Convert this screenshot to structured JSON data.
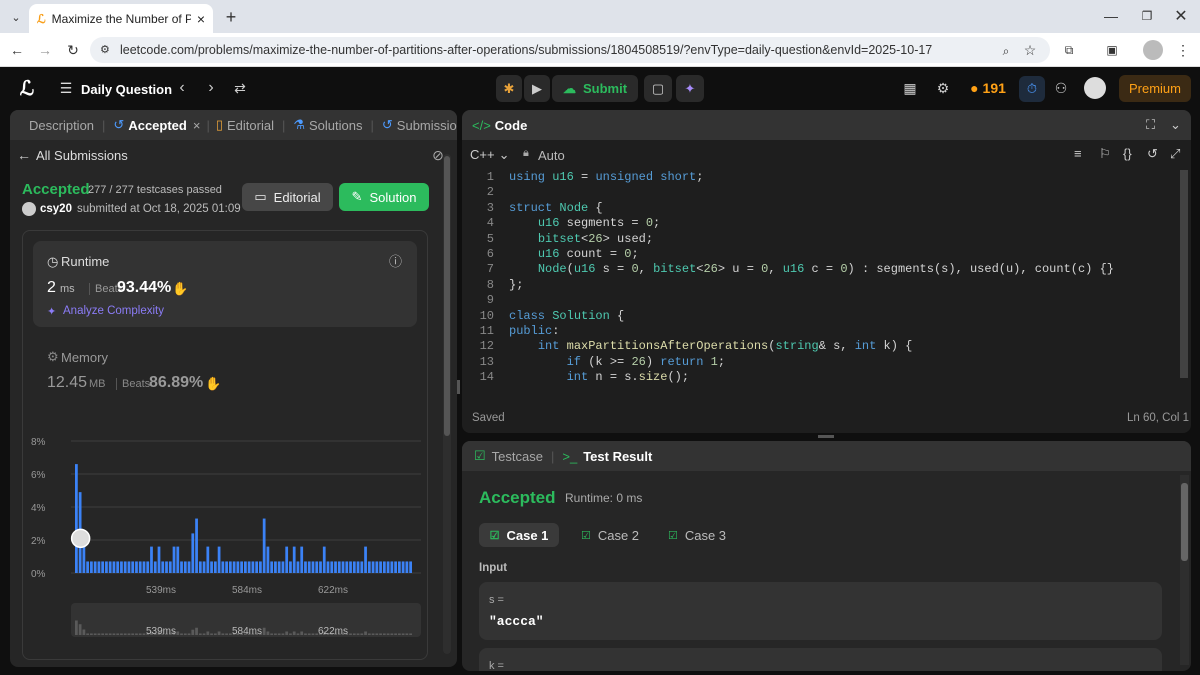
{
  "browser": {
    "tab_title": "Maximize the Number of Partitions",
    "url": "leetcode.com/problems/maximize-the-number-of-partitions-after-operations/submissions/1804508519/?envType=daily-question&envId=2025-10-17"
  },
  "nav": {
    "daily_label": "Daily Question",
    "submit_label": "Submit",
    "streak": "191",
    "premium_label": "Premium"
  },
  "left": {
    "tabs": [
      "Description",
      "Accepted",
      "Editorial",
      "Solutions",
      "Submission"
    ],
    "all_submissions": "All Submissions",
    "status": "Accepted",
    "testcases": "277 / 277 testcases passed",
    "user": "csy20",
    "submitted": "submitted at Oct 18, 2025 01:09",
    "editorial_btn": "Editorial",
    "solution_btn": "Solution",
    "runtime": {
      "label": "Runtime",
      "value": "2",
      "unit": "ms",
      "beats_label": "Beats",
      "beats": "93.44%",
      "analyze": "Analyze Complexity"
    },
    "memory": {
      "label": "Memory",
      "value": "12.45",
      "unit": "MB",
      "beats_label": "Beats",
      "beats": "86.89%"
    }
  },
  "chart_data": {
    "type": "bar",
    "y_ticks": [
      "8%",
      "6%",
      "4%",
      "2%",
      "0%"
    ],
    "ylim": [
      0,
      8
    ],
    "x_ticks": [
      "539ms",
      "584ms",
      "622ms"
    ],
    "values": [
      6.6,
      4.9,
      2.5,
      0.7,
      0.7,
      0.7,
      0.7,
      0.7,
      0.7,
      0.7,
      0.7,
      0.7,
      0.7,
      0.7,
      0.7,
      0.7,
      0.7,
      0.7,
      0.7,
      0.7,
      1.6,
      0.7,
      1.6,
      0.7,
      0.7,
      0.7,
      1.6,
      1.6,
      0.7,
      0.7,
      0.7,
      2.4,
      3.3,
      0.7,
      0.7,
      1.6,
      0.7,
      0.7,
      1.6,
      0.7,
      0.7,
      0.7,
      0.7,
      0.7,
      0.7,
      0.7,
      0.7,
      0.7,
      0.7,
      0.7,
      3.3,
      1.6,
      0.7,
      0.7,
      0.7,
      0.7,
      1.6,
      0.7,
      1.6,
      0.7,
      1.6,
      0.7,
      0.7,
      0.7,
      0.7,
      0.7,
      1.6,
      0.7,
      0.7,
      0.7,
      0.7,
      0.7,
      0.7,
      0.7,
      0.7,
      0.7,
      0.7,
      1.6,
      0.7,
      0.7,
      0.7,
      0.7,
      0.7,
      0.7,
      0.7,
      0.7,
      0.7,
      0.7,
      0.7,
      0.7
    ],
    "highlight_index": 1,
    "bar_color": "#3b82f6"
  },
  "code_panel": {
    "title": "Code",
    "language": "C++",
    "mode": "Auto",
    "saved": "Saved",
    "cursor": "Ln 60, Col 1",
    "lines": [
      {
        "n": "1",
        "t": "using u16 = unsigned short;"
      },
      {
        "n": "2",
        "t": ""
      },
      {
        "n": "3",
        "t": "struct Node {"
      },
      {
        "n": "4",
        "t": "    u16 segments = 0;"
      },
      {
        "n": "5",
        "t": "    bitset<26> used;"
      },
      {
        "n": "6",
        "t": "    u16 count = 0;"
      },
      {
        "n": "7",
        "t": "    Node(u16 s = 0, bitset<26> u = 0, u16 c = 0) : segments(s), used(u), count(c) {}"
      },
      {
        "n": "8",
        "t": "};"
      },
      {
        "n": "9",
        "t": ""
      },
      {
        "n": "10",
        "t": "class Solution {"
      },
      {
        "n": "11",
        "t": "public:"
      },
      {
        "n": "12",
        "t": "    int maxPartitionsAfterOperations(string& s, int k) {"
      },
      {
        "n": "13",
        "t": "        if (k >= 26) return 1;"
      },
      {
        "n": "14",
        "t": "        int n = s.size();"
      }
    ]
  },
  "result_panel": {
    "tab_testcase": "Testcase",
    "tab_result": "Test Result",
    "status": "Accepted",
    "runtime": "Runtime: 0 ms",
    "cases": [
      "Case 1",
      "Case 2",
      "Case 3"
    ],
    "input_label": "Input",
    "var1": "s =",
    "val1": "\"accca\"",
    "var2": "k ="
  },
  "colors": {
    "accent_green": "#2cbb5d",
    "accent_orange": "#ffa116",
    "accent_blue": "#3b82f6",
    "background": "#262626"
  }
}
